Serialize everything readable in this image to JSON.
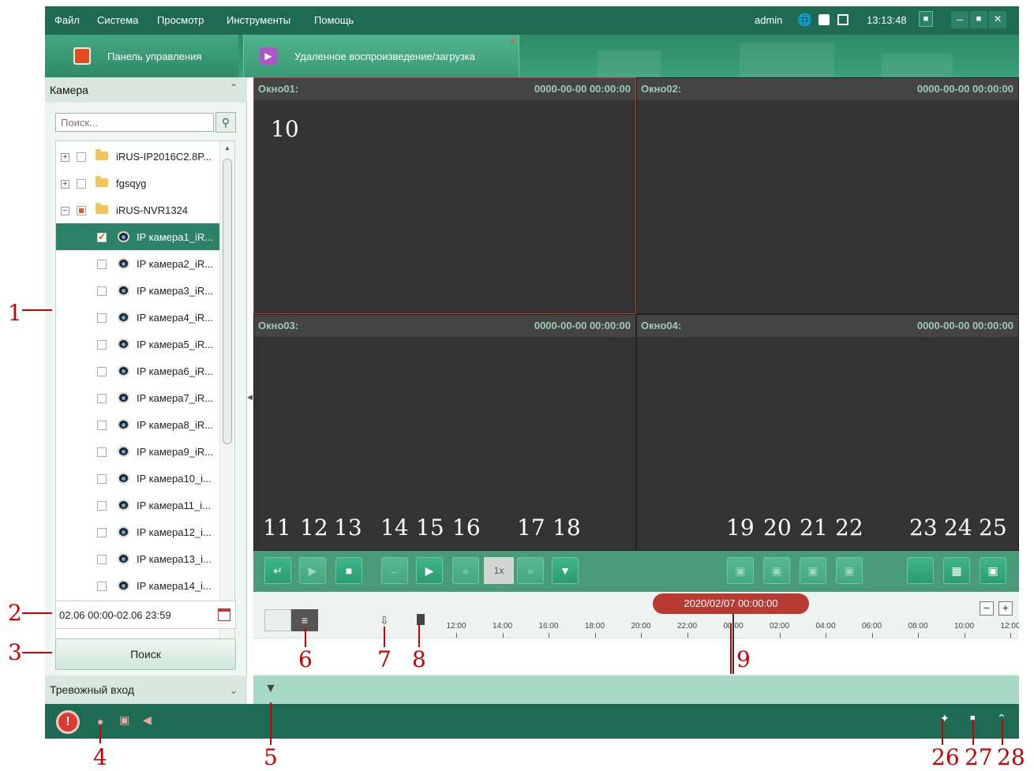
{
  "menu": {
    "items": [
      "Файл",
      "Система",
      "Просмотр",
      "Инструменты",
      "Помощь"
    ]
  },
  "header": {
    "user": "admin",
    "time": "13:13:48"
  },
  "tabs": [
    {
      "label": "Панель управления",
      "icon": "home-icon"
    },
    {
      "label": "Удаленное воспроизведение/загрузка",
      "icon": "play-icon"
    }
  ],
  "sidebar": {
    "camera_header": "Камера",
    "search_placeholder": "Поиск...",
    "tree": [
      {
        "label": "iRUS-IP2016C2.8P...",
        "type": "folder",
        "expander": "+"
      },
      {
        "label": "fgsqyg",
        "type": "folder",
        "expander": "+"
      },
      {
        "label": "iRUS-NVR1324",
        "type": "folder",
        "expander": "−"
      },
      {
        "label": "IP камера1_iR...",
        "type": "camera",
        "checked": true
      },
      {
        "label": "IP камера2_iR...",
        "type": "camera"
      },
      {
        "label": "IP камера3_iR...",
        "type": "camera"
      },
      {
        "label": "IP камера4_iR...",
        "type": "camera"
      },
      {
        "label": "IP камера5_iR...",
        "type": "camera"
      },
      {
        "label": "IP камера6_iR...",
        "type": "camera"
      },
      {
        "label": "IP камера7_iR...",
        "type": "camera"
      },
      {
        "label": "IP камера8_iR...",
        "type": "camera"
      },
      {
        "label": "IP камера9_iR...",
        "type": "camera"
      },
      {
        "label": "IP камера10_i...",
        "type": "camera"
      },
      {
        "label": "IP камера11_i...",
        "type": "camera"
      },
      {
        "label": "IP камера12_i...",
        "type": "camera"
      },
      {
        "label": "IP камера13_i...",
        "type": "camera"
      },
      {
        "label": "IP камера14_i...",
        "type": "camera"
      }
    ],
    "date_range": "02.06 00:00-02.06 23:59",
    "search_button": "Поиск",
    "alarm_header": "Тревожный вход"
  },
  "panes": [
    {
      "name": "Окно01:",
      "time": "0000-00-00 00:00:00"
    },
    {
      "name": "Окно02:",
      "time": "0000-00-00 00:00:00"
    },
    {
      "name": "Окно03:",
      "time": "0000-00-00 00:00:00"
    },
    {
      "name": "Окно04:",
      "time": "0000-00-00 00:00:00"
    }
  ],
  "controls": {
    "speed": "1x"
  },
  "timeline": {
    "date": "2020/02/07 00:00:00",
    "ticks": [
      "12:00",
      "14:00",
      "16:00",
      "18:00",
      "20:00",
      "22:00",
      "00:00",
      "02:00",
      "04:00",
      "06:00",
      "08:00",
      "10:00",
      "12:00"
    ]
  },
  "annotations": [
    "1",
    "2",
    "3",
    "4",
    "5",
    "6",
    "7",
    "8",
    "9",
    "10",
    "11",
    "12",
    "13",
    "14",
    "15",
    "16",
    "17",
    "18",
    "19",
    "20",
    "21",
    "22",
    "23",
    "24",
    "25",
    "26",
    "27",
    "28"
  ]
}
